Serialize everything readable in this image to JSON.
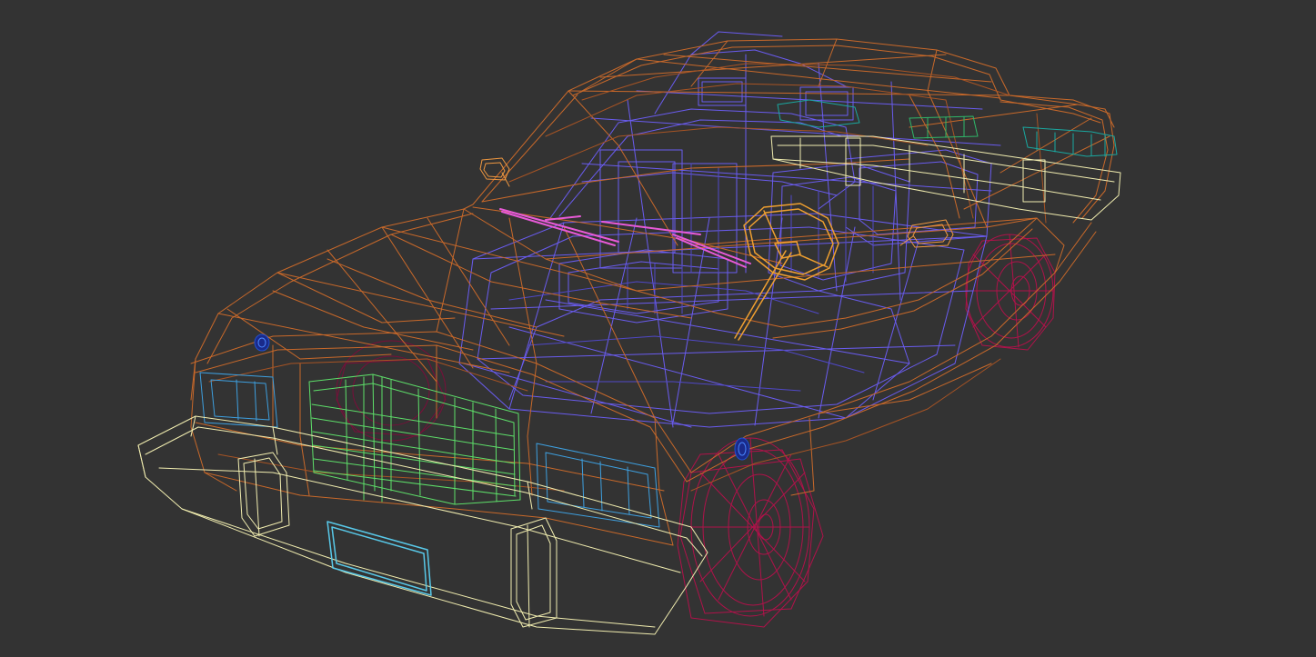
{
  "viewport": {
    "background": "#333333",
    "model": "wireframe car",
    "colors": {
      "body": "#c9692a",
      "body_dark": "#a85424",
      "interior": "#6a5cf0",
      "interior_dark": "#5048c8",
      "bumper": "#f2eeb0",
      "grille": "#5ee06a",
      "headlight": "#3ea0e0",
      "plate": "#58c8e8",
      "wheels": "#b0124a",
      "wheels_dark": "#7a0e3a",
      "wipers": "#e85ad8",
      "steering_wheel": "#f0a030",
      "mirror": "#f09840",
      "marker": "#2050d0",
      "rear_trim": "#1aa8a0",
      "rear_green": "#2fb86a"
    }
  }
}
